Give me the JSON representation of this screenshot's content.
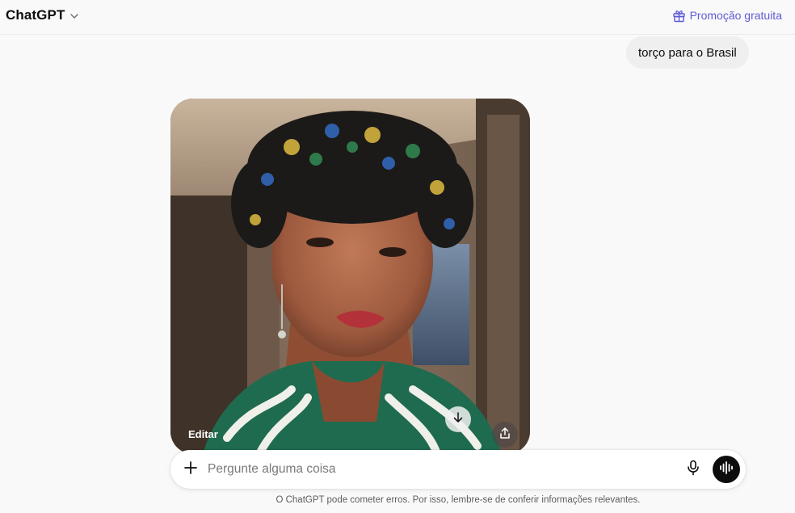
{
  "header": {
    "model_name": "ChatGPT",
    "promo_label": "Promoção gratuita",
    "accent_color": "#5d5bd4"
  },
  "conversation": {
    "user_message": "torço para o Brasil",
    "image_card": {
      "edit_label": "Editar",
      "actions": [
        "download-icon",
        "share-icon"
      ]
    }
  },
  "composer": {
    "placeholder": "Pergunte alguma coisa",
    "icons": [
      "plus-icon",
      "microphone-icon",
      "voice-mode-icon"
    ]
  },
  "footer": {
    "disclaimer": "O ChatGPT pode cometer erros. Por isso, lembre-se de conferir informações relevantes."
  }
}
